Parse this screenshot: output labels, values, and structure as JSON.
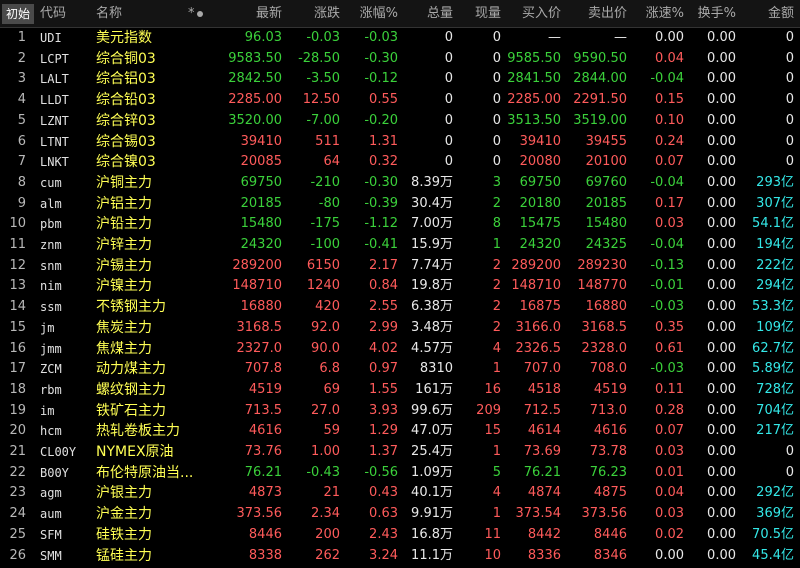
{
  "header": {
    "start_tab": "初始",
    "columns": [
      "代码",
      "名称",
      "",
      "最新",
      "涨跌",
      "涨幅%",
      "总量",
      "现量",
      "买入价",
      "卖出价",
      "涨速%",
      "换手%",
      "金额"
    ],
    "star": "*"
  },
  "colors": {
    "up": "#ff5b5b",
    "down": "#3bd13b",
    "flat": "#e8e8e8",
    "name": "#ffff54",
    "amount": "#34e8e8"
  },
  "rows": [
    {
      "idx": "1",
      "code": "UDI",
      "name": "美元指数",
      "last": "96.03",
      "chg": "-0.03",
      "pct": "-0.03",
      "vol": "0",
      "cur": "0",
      "bid": "—",
      "ask": "—",
      "speed": "0.00",
      "turn": "0.00",
      "amt": "0",
      "dir": "down"
    },
    {
      "idx": "2",
      "code": "LCPT",
      "name": "综合铜03",
      "last": "9583.50",
      "chg": "-28.50",
      "pct": "-0.30",
      "vol": "0",
      "cur": "0",
      "bid": "9585.50",
      "ask": "9590.50",
      "speed": "0.04",
      "turn": "0.00",
      "amt": "0",
      "dir": "down"
    },
    {
      "idx": "3",
      "code": "LALT",
      "name": "综合铝03",
      "last": "2842.50",
      "chg": "-3.50",
      "pct": "-0.12",
      "vol": "0",
      "cur": "0",
      "bid": "2841.50",
      "ask": "2844.00",
      "speed": "-0.04",
      "turn": "0.00",
      "amt": "0",
      "dir": "down"
    },
    {
      "idx": "4",
      "code": "LLDT",
      "name": "综合铅03",
      "last": "2285.00",
      "chg": "12.50",
      "pct": "0.55",
      "vol": "0",
      "cur": "0",
      "bid": "2285.00",
      "ask": "2291.50",
      "speed": "0.15",
      "turn": "0.00",
      "amt": "0",
      "dir": "up"
    },
    {
      "idx": "5",
      "code": "LZNT",
      "name": "综合锌03",
      "last": "3520.00",
      "chg": "-7.00",
      "pct": "-0.20",
      "vol": "0",
      "cur": "0",
      "bid": "3513.50",
      "ask": "3519.00",
      "speed": "0.10",
      "turn": "0.00",
      "amt": "0",
      "dir": "down"
    },
    {
      "idx": "6",
      "code": "LTNT",
      "name": "综合锡03",
      "last": "39410",
      "chg": "511",
      "pct": "1.31",
      "vol": "0",
      "cur": "0",
      "bid": "39410",
      "ask": "39455",
      "speed": "0.24",
      "turn": "0.00",
      "amt": "0",
      "dir": "up"
    },
    {
      "idx": "7",
      "code": "LNKT",
      "name": "综合镍03",
      "last": "20085",
      "chg": "64",
      "pct": "0.32",
      "vol": "0",
      "cur": "0",
      "bid": "20080",
      "ask": "20100",
      "speed": "0.07",
      "turn": "0.00",
      "amt": "0",
      "dir": "up"
    },
    {
      "idx": "8",
      "code": "cum",
      "name": "沪铜主力",
      "last": "69750",
      "chg": "-210",
      "pct": "-0.30",
      "vol": "8.39万",
      "cur": "3",
      "bid": "69750",
      "ask": "69760",
      "speed": "-0.04",
      "turn": "0.00",
      "amt": "293亿",
      "dir": "down"
    },
    {
      "idx": "9",
      "code": "alm",
      "name": "沪铝主力",
      "last": "20185",
      "chg": "-80",
      "pct": "-0.39",
      "vol": "30.4万",
      "cur": "2",
      "bid": "20180",
      "ask": "20185",
      "speed": "0.17",
      "turn": "0.00",
      "amt": "307亿",
      "dir": "down"
    },
    {
      "idx": "10",
      "code": "pbm",
      "name": "沪铅主力",
      "last": "15480",
      "chg": "-175",
      "pct": "-1.12",
      "vol": "7.00万",
      "cur": "8",
      "bid": "15475",
      "ask": "15480",
      "speed": "0.03",
      "turn": "0.00",
      "amt": "54.1亿",
      "dir": "down"
    },
    {
      "idx": "11",
      "code": "znm",
      "name": "沪锌主力",
      "last": "24320",
      "chg": "-100",
      "pct": "-0.41",
      "vol": "15.9万",
      "cur": "1",
      "bid": "24320",
      "ask": "24325",
      "speed": "-0.04",
      "turn": "0.00",
      "amt": "194亿",
      "dir": "down"
    },
    {
      "idx": "12",
      "code": "snm",
      "name": "沪锡主力",
      "last": "289200",
      "chg": "6150",
      "pct": "2.17",
      "vol": "7.74万",
      "cur": "2",
      "bid": "289200",
      "ask": "289230",
      "speed": "-0.13",
      "turn": "0.00",
      "amt": "222亿",
      "dir": "up"
    },
    {
      "idx": "13",
      "code": "nim",
      "name": "沪镍主力",
      "last": "148710",
      "chg": "1240",
      "pct": "0.84",
      "vol": "19.8万",
      "cur": "2",
      "bid": "148710",
      "ask": "148770",
      "speed": "-0.01",
      "turn": "0.00",
      "amt": "294亿",
      "dir": "up"
    },
    {
      "idx": "14",
      "code": "ssm",
      "name": "不锈钢主力",
      "last": "16880",
      "chg": "420",
      "pct": "2.55",
      "vol": "6.38万",
      "cur": "2",
      "bid": "16875",
      "ask": "16880",
      "speed": "-0.03",
      "turn": "0.00",
      "amt": "53.3亿",
      "dir": "up"
    },
    {
      "idx": "15",
      "code": "jm",
      "name": "焦炭主力",
      "last": "3168.5",
      "chg": "92.0",
      "pct": "2.99",
      "vol": "3.48万",
      "cur": "2",
      "bid": "3166.0",
      "ask": "3168.5",
      "speed": "0.35",
      "turn": "0.00",
      "amt": "109亿",
      "dir": "up"
    },
    {
      "idx": "16",
      "code": "jmm",
      "name": "焦煤主力",
      "last": "2327.0",
      "chg": "90.0",
      "pct": "4.02",
      "vol": "4.57万",
      "cur": "4",
      "bid": "2326.5",
      "ask": "2328.0",
      "speed": "0.61",
      "turn": "0.00",
      "amt": "62.7亿",
      "dir": "up"
    },
    {
      "idx": "17",
      "code": "ZCM",
      "name": "动力煤主力",
      "last": "707.8",
      "chg": "6.8",
      "pct": "0.97",
      "vol": "8310",
      "cur": "1",
      "bid": "707.0",
      "ask": "708.0",
      "speed": "-0.03",
      "turn": "0.00",
      "amt": "5.89亿",
      "dir": "up"
    },
    {
      "idx": "18",
      "code": "rbm",
      "name": "螺纹钢主力",
      "last": "4519",
      "chg": "69",
      "pct": "1.55",
      "vol": "161万",
      "cur": "16",
      "bid": "4518",
      "ask": "4519",
      "speed": "0.11",
      "turn": "0.00",
      "amt": "728亿",
      "dir": "up"
    },
    {
      "idx": "19",
      "code": "im",
      "name": "铁矿石主力",
      "last": "713.5",
      "chg": "27.0",
      "pct": "3.93",
      "vol": "99.6万",
      "cur": "209",
      "bid": "712.5",
      "ask": "713.0",
      "speed": "0.28",
      "turn": "0.00",
      "amt": "704亿",
      "dir": "up"
    },
    {
      "idx": "20",
      "code": "hcm",
      "name": "热轧卷板主力",
      "last": "4616",
      "chg": "59",
      "pct": "1.29",
      "vol": "47.0万",
      "cur": "15",
      "bid": "4614",
      "ask": "4616",
      "speed": "0.07",
      "turn": "0.00",
      "amt": "217亿",
      "dir": "up"
    },
    {
      "idx": "21",
      "code": "CL00Y",
      "name": "NYMEX原油",
      "last": "73.76",
      "chg": "1.00",
      "pct": "1.37",
      "vol": "25.4万",
      "cur": "1",
      "bid": "73.69",
      "ask": "73.78",
      "speed": "0.03",
      "turn": "0.00",
      "amt": "0",
      "dir": "up"
    },
    {
      "idx": "22",
      "code": "B00Y",
      "name": "布伦特原油当...",
      "last": "76.21",
      "chg": "-0.43",
      "pct": "-0.56",
      "vol": "1.09万",
      "cur": "5",
      "bid": "76.21",
      "ask": "76.23",
      "speed": "0.01",
      "turn": "0.00",
      "amt": "0",
      "dir": "down"
    },
    {
      "idx": "23",
      "code": "agm",
      "name": "沪银主力",
      "last": "4873",
      "chg": "21",
      "pct": "0.43",
      "vol": "40.1万",
      "cur": "4",
      "bid": "4874",
      "ask": "4875",
      "speed": "0.04",
      "turn": "0.00",
      "amt": "292亿",
      "dir": "up"
    },
    {
      "idx": "24",
      "code": "aum",
      "name": "沪金主力",
      "last": "373.56",
      "chg": "2.34",
      "pct": "0.63",
      "vol": "9.91万",
      "cur": "1",
      "bid": "373.54",
      "ask": "373.56",
      "speed": "0.03",
      "turn": "0.00",
      "amt": "369亿",
      "dir": "up"
    },
    {
      "idx": "25",
      "code": "SFM",
      "name": "硅铁主力",
      "last": "8446",
      "chg": "200",
      "pct": "2.43",
      "vol": "16.8万",
      "cur": "11",
      "bid": "8442",
      "ask": "8446",
      "speed": "0.02",
      "turn": "0.00",
      "amt": "70.5亿",
      "dir": "up"
    },
    {
      "idx": "26",
      "code": "SMM",
      "name": "锰硅主力",
      "last": "8338",
      "chg": "262",
      "pct": "3.24",
      "vol": "11.1万",
      "cur": "10",
      "bid": "8336",
      "ask": "8346",
      "speed": "0.00",
      "turn": "0.00",
      "amt": "45.4亿",
      "dir": "up"
    }
  ]
}
